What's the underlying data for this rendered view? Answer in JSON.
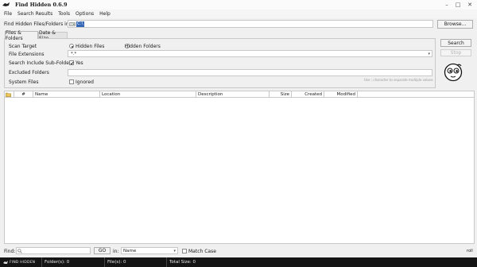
{
  "window": {
    "title": "Find Hidden 0.6.9",
    "icon": "app-icon",
    "controls": [
      "minimize",
      "maximize",
      "close"
    ]
  },
  "menu": {
    "items": [
      "File",
      "Search Results",
      "Tools",
      "Options",
      "Help"
    ]
  },
  "search_path": {
    "label": "Find Hidden Files/Folders in:",
    "value": "C:\\",
    "browse_label": "Browse..."
  },
  "tabs": [
    "Files & Folders",
    "Date & Size"
  ],
  "options": {
    "scan_target": {
      "label": "Scan Target",
      "hidden_files_label": "Hidden Files",
      "hidden_folders_label": "Hidden Folders",
      "selected": "Hidden Files"
    },
    "file_extensions": {
      "label": "File Extensions",
      "value": "*.*"
    },
    "include_subfolders": {
      "label": "Search Include Sub-Folders",
      "checkbox_label": "Yes",
      "checked": true
    },
    "excluded_folders": {
      "label": "Excluded Folders",
      "value": "",
      "hint": "Use ; character to separate multiple values"
    },
    "system_files": {
      "label": "System Files",
      "checkbox_label": "Ignored",
      "checked": false
    }
  },
  "actions": {
    "search_label": "Search",
    "stop_label": "Stop"
  },
  "results": {
    "columns": [
      "#",
      "Name",
      "Location",
      "Description",
      "Size",
      "Created",
      "Modified"
    ],
    "rows": []
  },
  "find_bar": {
    "label": "Find:",
    "value": "",
    "go_label": "GO",
    "in_label": "in:",
    "field_value": "Name",
    "match_case_label": "Match Case",
    "match_case_checked": false,
    "scroll_indicator": "roll"
  },
  "status": {
    "brand": "FIND HIDDEN",
    "folders": "Folder(s): 0",
    "files": "File(s): 0",
    "total_size": "Total Size: 0"
  }
}
